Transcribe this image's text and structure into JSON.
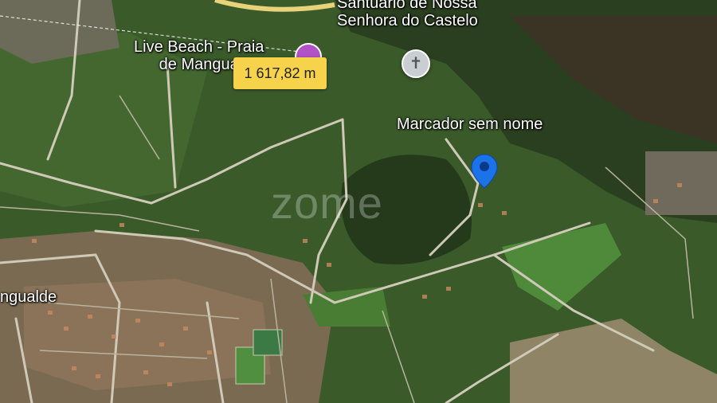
{
  "map": {
    "type": "satellite",
    "labels": {
      "sanctuary": [
        "Santuário de Nossa",
        "Senhora do Castelo"
      ],
      "beach": [
        "Live Beach - Praia",
        "de Mangua"
      ],
      "marker": "Marcador sem nome",
      "town": "ngualde"
    },
    "distance": "1 617,82 m",
    "watermark": "zome",
    "icons": {
      "church": "church-cross-icon",
      "beach": "beach-poi-icon",
      "marker": "map-pin-icon"
    },
    "colors": {
      "distance_bg": "#f7d34c",
      "marker": "#1a73e8",
      "beach_poi": "#b152c7"
    }
  }
}
